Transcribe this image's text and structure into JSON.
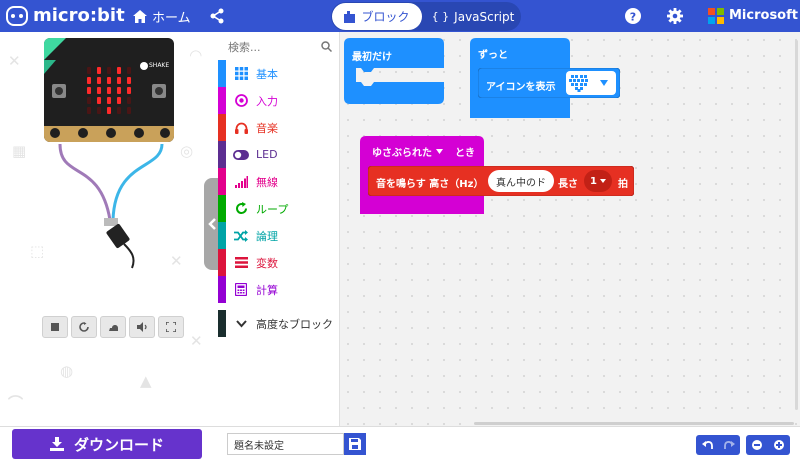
{
  "header": {
    "brand": "micro:bit",
    "home_label": "ホーム",
    "blocks_tab": "ブロック",
    "javascript_tab": "JavaScript",
    "company": "Microsoft"
  },
  "simulator": {
    "shake_label": "SHAKE"
  },
  "toolbox": {
    "search_placeholder": "検索...",
    "categories": [
      {
        "label": "基本",
        "color": "#1e90ff",
        "icon": "grid-icon"
      },
      {
        "label": "入力",
        "color": "#d400d4",
        "icon": "target-icon"
      },
      {
        "label": "音楽",
        "color": "#e63022",
        "icon": "headphones-icon"
      },
      {
        "label": "LED",
        "color": "#5c2d91",
        "icon": "toggle-icon"
      },
      {
        "label": "無線",
        "color": "#e3008c",
        "icon": "signal-icon"
      },
      {
        "label": "ループ",
        "color": "#00aa00",
        "icon": "loop-icon"
      },
      {
        "label": "論理",
        "color": "#00a4a6",
        "icon": "shuffle-icon"
      },
      {
        "label": "変数",
        "color": "#dc143c",
        "icon": "list-icon"
      },
      {
        "label": "計算",
        "color": "#9400d3",
        "icon": "calculator-icon"
      }
    ],
    "advanced_label": "高度なブロック"
  },
  "workspace": {
    "on_start_label": "最初だけ",
    "forever_label": "ずっと",
    "show_icon_label": "アイコンを表示",
    "on_gesture_label": "ゆさぶられた",
    "on_gesture_suffix": "とき",
    "play_tone_label": "音を鳴らす 高さ（Hz）",
    "play_tone_note": "真ん中のド",
    "play_tone_length": "長さ",
    "play_tone_beat_value": "1",
    "play_tone_beat_unit": "拍"
  },
  "bottom": {
    "download_label": "ダウンロード",
    "project_name": "題名未設定"
  },
  "colors": {
    "brand_blue": "#3454d1",
    "basic_block": "#1e90ff",
    "input_block": "#d400d4",
    "music_block": "#e63022",
    "download": "#6633cc"
  }
}
